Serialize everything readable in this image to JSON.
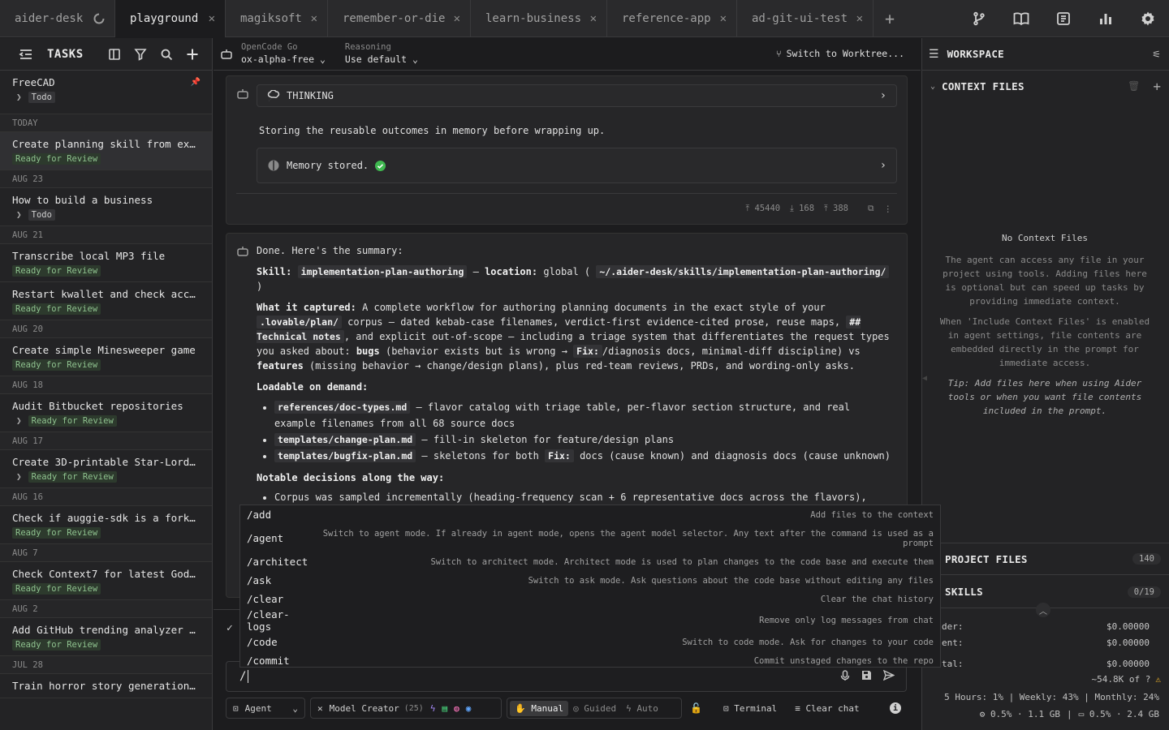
{
  "tabs": [
    {
      "label": "aider-desk",
      "active": false
    },
    {
      "label": "playground",
      "active": true
    },
    {
      "label": "magiksoft",
      "active": false
    },
    {
      "label": "remember-or-die",
      "active": false
    },
    {
      "label": "learn-business",
      "active": false
    },
    {
      "label": "reference-app",
      "active": false
    },
    {
      "label": "ad-git-ui-test",
      "active": false
    }
  ],
  "sidebar": {
    "title": "TASKS",
    "pinned": {
      "name": "FreeCAD",
      "badge": "Todo"
    },
    "groups": [
      {
        "date": "TODAY",
        "tasks": [
          {
            "name": "Create planning skill from exis…",
            "badge": "Ready for Review",
            "chev": false,
            "selected": true
          }
        ]
      },
      {
        "date": "AUG 23",
        "tasks": [
          {
            "name": "How to build a business",
            "badge": "Todo",
            "chev": true
          }
        ]
      },
      {
        "date": "AUG 21",
        "tasks": [
          {
            "name": "Transcribe local MP3 file",
            "badge": "Ready for Review",
            "chev": false
          },
          {
            "name": "Restart kwallet and check accou…",
            "badge": "Ready for Review",
            "chev": false
          }
        ]
      },
      {
        "date": "AUG 20",
        "tasks": [
          {
            "name": "Create simple Minesweeper game",
            "badge": "Ready for Review",
            "chev": false
          }
        ]
      },
      {
        "date": "AUG 18",
        "tasks": [
          {
            "name": "Audit Bitbucket repositories",
            "badge": "Ready for Review",
            "chev": true
          }
        ]
      },
      {
        "date": "AUG 17",
        "tasks": [
          {
            "name": "Create 3D-printable Star-Lord m…",
            "badge": "Ready for Review",
            "chev": true
          }
        ]
      },
      {
        "date": "AUG 16",
        "tasks": [
          {
            "name": "Check if auggie-sdk is a fork o…",
            "badge": "Ready for Review",
            "chev": false
          }
        ]
      },
      {
        "date": "AUG 7",
        "tasks": [
          {
            "name": "Check Context7 for latest Godot…",
            "badge": "Ready for Review",
            "chev": false
          }
        ]
      },
      {
        "date": "AUG 2",
        "tasks": [
          {
            "name": "Add GitHub trending analyzer ex…",
            "badge": "Ready for Review",
            "chev": false
          }
        ]
      },
      {
        "date": "JUL 28",
        "tasks": [
          {
            "name": "Train horror story generation m…",
            "badge": "",
            "chev": false
          }
        ]
      }
    ]
  },
  "header": {
    "provider_key": "OpenCode Go",
    "provider_val": "ox-alpha-free",
    "reasoning_key": "Reasoning",
    "reasoning_val": "Use default",
    "worktree": "Switch to Worktree..."
  },
  "msg1": {
    "thinking": "THINKING",
    "text": "Storing the reusable outcomes in memory before wrapping up.",
    "memory": "Memory stored.",
    "tokens_up": "45440",
    "tokens_down": "168",
    "tokens_total": "388"
  },
  "msg2": {
    "intro": "Done. Here's the summary:",
    "skill_label": "Skill:",
    "skill_code": "implementation-plan-authoring",
    "loc_label": "location:",
    "loc_pre": "global (",
    "loc_code": "~/.aider-desk/skills/implementation-plan-authoring/",
    "loc_post": ")",
    "cap_label": "What it captured:",
    "cap_1": "A complete workflow for authoring planning documents in the exact style of your",
    "cap_code1": ".lovable/plan/",
    "cap_2": "corpus — dated kebab-case filenames, verdict-first evidence-cited prose, reuse maps,",
    "cap_code2": "## Technical notes",
    "cap_3": ", and explicit out-of-scope — including a triage system that differentiates the request types you asked about:",
    "cap_bugs": "bugs",
    "cap_4": "(behavior exists but is wrong →",
    "cap_code3": "Fix:",
    "cap_5": "/diagnosis docs, minimal-diff discipline) vs",
    "cap_feat": "features",
    "cap_6": "(missing behavior → change/design plans), plus red-team reviews, PRDs, and wording-only asks.",
    "load_label": "Loadable on demand:",
    "load_items": [
      {
        "code": "references/doc-types.md",
        "text": "— flavor catalog with triage table, per-flavor section structure, and real example filenames from all 68 source docs"
      },
      {
        "code": "templates/change-plan.md",
        "text": "— fill-in skeleton for feature/design plans"
      },
      {
        "code": "templates/bugfix-plan.md",
        "text": "— skeletons for both",
        "code2": "Fix:",
        "text2": "docs (cause known) and diagnosis docs (cause unknown)"
      }
    ],
    "notable_label": "Notable decisions along the way:",
    "notable_items": [
      "Corpus was sampled incrementally (heading-frequency scan + 6 representative docs across the flavors), never loaded whole"
    ]
  },
  "commands": [
    {
      "name": "/add",
      "desc": "Add files to the context"
    },
    {
      "name": "/agent",
      "desc": "Switch to agent mode. If already in agent mode, opens the agent model selector. Any text after the command is used as a prompt"
    },
    {
      "name": "/architect",
      "desc": "Switch to architect mode. Architect mode is used to plan changes to the code base and execute them"
    },
    {
      "name": "/ask",
      "desc": "Switch to ask mode. Ask questions about the code base without editing any files"
    },
    {
      "name": "/clear",
      "desc": "Clear the chat history"
    },
    {
      "name": "/clear-logs",
      "desc": "Remove only log messages from chat"
    },
    {
      "name": "/code",
      "desc": "Switch to code mode. Ask for changes to your code"
    },
    {
      "name": "/commit",
      "desc": "Commit unstaged changes to the repo"
    }
  ],
  "input": {
    "value": "/"
  },
  "bottombar": {
    "agent": "Agent",
    "model": "Model Creator",
    "model_count": "(25)",
    "manual": "Manual",
    "guided": "Guided",
    "auto": "Auto",
    "terminal": "Terminal",
    "clear": "Clear chat"
  },
  "right": {
    "title": "WORKSPACE",
    "context_title": "CONTEXT FILES",
    "no_ctx": "No Context Files",
    "info1": "The agent can access any file in your project using tools. Adding files here is optional but can speed up tasks by providing immediate context.",
    "info2": "When 'Include Context Files' is enabled in agent settings, file contents are embedded directly in the prompt for immediate access.",
    "tip": "Tip: Add files here when using Aider tools or when you want file contents included in the prompt.",
    "project_title": "PROJECT FILES",
    "project_count": "140",
    "skills_title": "SKILLS",
    "skills_count": "0/19",
    "cost_rows": [
      {
        "k": "der:",
        "v": "$0.00000"
      },
      {
        "k": "ent:",
        "v": "$0.00000"
      },
      {
        "k": "tal:",
        "v": "$0.00000"
      }
    ],
    "tokens": "~54.8K of ?",
    "usage": "5 Hours: 1% | Weekly: 43% | Monthly: 24%",
    "sys_cpu": "0.5% · 1.1 GB",
    "sys_mem": "0.5% · 2.4 GB"
  },
  "colors": {
    "accent_green": "#8fc28f",
    "warn": "#f0b429",
    "check": "#3fb950"
  }
}
